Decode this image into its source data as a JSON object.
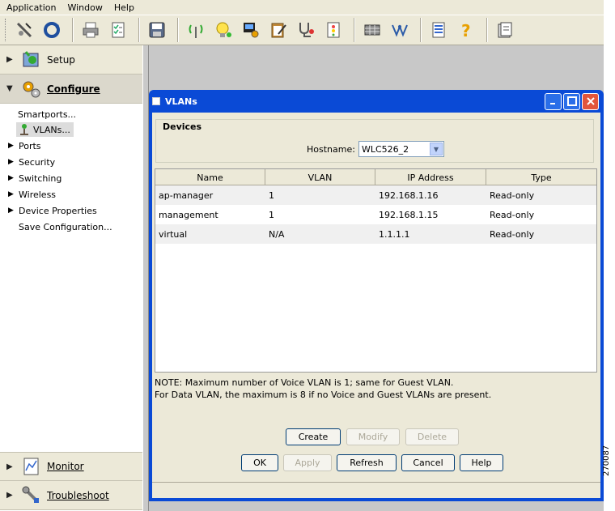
{
  "menu": {
    "items": [
      "Application",
      "Window",
      "Help"
    ]
  },
  "toolbar": {
    "icons": [
      "connect-icon",
      "refresh-icon",
      "print-icon",
      "checklist-icon",
      "save-icon",
      "wireless-icon",
      "bulb-icon",
      "device-gear-icon",
      "clipboard-icon",
      "stethoscope-icon",
      "report-icon",
      "grid-icon",
      "network-icon",
      "list-icon",
      "help-icon",
      "book-icon"
    ]
  },
  "sidebar": {
    "setup": "Setup",
    "configure": "Configure",
    "items": {
      "smartports": "Smartports...",
      "vlans": "VLANs...",
      "ports": "Ports",
      "security": "Security",
      "switching": "Switching",
      "wireless": "Wireless",
      "device_properties": "Device Properties",
      "save_configuration": "Save Configuration..."
    },
    "monitor": "Monitor",
    "troubleshoot": "Troubleshoot"
  },
  "dialog": {
    "title": "VLANs",
    "devices_title": "Devices",
    "hostname_label": "Hostname:",
    "hostname_value": "WLC526_2",
    "columns": [
      "Name",
      "VLAN",
      "IP Address",
      "Type"
    ],
    "rows": [
      [
        "ap-manager",
        "1",
        "192.168.1.16",
        "Read-only"
      ],
      [
        "management",
        "1",
        "192.168.1.15",
        "Read-only"
      ],
      [
        "virtual",
        "N/A",
        "1.1.1.1",
        "Read-only"
      ]
    ],
    "note_line1": "NOTE: Maximum number of Voice VLAN is 1; same for Guest VLAN.",
    "note_line2": "For Data VLAN, the maximum is 8 if no Voice and Guest VLANs are present.",
    "buttons": {
      "create": "Create",
      "modify": "Modify",
      "delete": "Delete",
      "ok": "OK",
      "apply": "Apply",
      "refresh": "Refresh",
      "cancel": "Cancel",
      "help": "Help"
    }
  },
  "figure_number": "270087",
  "colors": {
    "title_bar": "#0a4ad6",
    "dialog_body": "#ece9d8",
    "close_button": "#e2553b"
  }
}
